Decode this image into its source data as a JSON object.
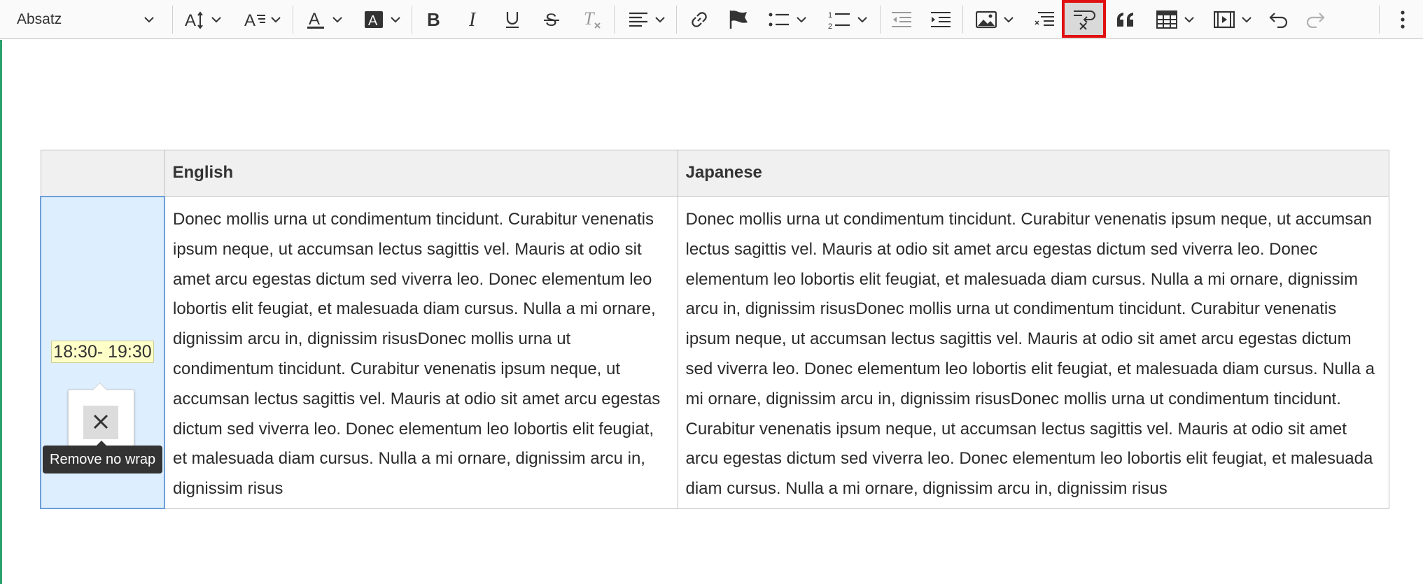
{
  "toolbar": {
    "heading": "Absatz",
    "buttons": [
      {
        "name": "font-size",
        "icon": "font-size-icon"
      },
      {
        "name": "font-family",
        "icon": "font-family-icon"
      },
      {
        "name": "font-color",
        "icon": "font-color-icon"
      },
      {
        "name": "background-color",
        "icon": "background-color-icon"
      },
      {
        "name": "bold",
        "icon": "bold-icon"
      },
      {
        "name": "italic",
        "icon": "italic-icon"
      },
      {
        "name": "underline",
        "icon": "underline-icon"
      },
      {
        "name": "strikethrough",
        "icon": "strikethrough-icon"
      },
      {
        "name": "remove-format",
        "icon": "remove-format-icon"
      },
      {
        "name": "alignment",
        "icon": "align-left-icon"
      },
      {
        "name": "link",
        "icon": "link-icon"
      },
      {
        "name": "bookmark",
        "icon": "flag-icon"
      },
      {
        "name": "bulleted-list",
        "icon": "bulleted-list-icon"
      },
      {
        "name": "numbered-list",
        "icon": "numbered-list-icon"
      },
      {
        "name": "outdent",
        "icon": "outdent-icon"
      },
      {
        "name": "indent",
        "icon": "indent-icon"
      },
      {
        "name": "insert-image",
        "icon": "image-icon"
      },
      {
        "name": "text-part-language",
        "icon": "text-language-icon"
      },
      {
        "name": "no-wrap",
        "icon": "no-wrap-icon",
        "active": true
      },
      {
        "name": "block-quote",
        "icon": "quote-icon"
      },
      {
        "name": "insert-table",
        "icon": "table-icon"
      },
      {
        "name": "media-embed",
        "icon": "media-icon"
      },
      {
        "name": "undo",
        "icon": "undo-icon"
      },
      {
        "name": "redo",
        "icon": "redo-icon"
      },
      {
        "name": "more",
        "icon": "more-vertical-icon"
      }
    ],
    "highlight_color": "#e01010"
  },
  "table": {
    "headers": [
      "",
      "English",
      "Japanese"
    ],
    "time": "18:30- 19:30",
    "english": "Donec mollis urna ut condimentum tincidunt. Curabitur venenatis ipsum neque, ut accumsan lectus sagittis vel. Mauris at odio sit amet arcu egestas dictum sed viverra leo. Donec elementum leo lobortis elit feugiat, et malesuada diam cursus. Nulla a mi ornare, dignissim arcu in, dignissim risusDonec mollis urna ut condimentum tincidunt. Curabitur venenatis ipsum neque, ut accumsan lectus sagittis vel. Mauris at odio sit amet arcu egestas dictum sed viverra leo. Donec elementum leo lobortis elit feugiat, et malesuada diam cursus. Nulla a mi ornare, dignissim arcu in, dignissim risus",
    "japanese": "Donec mollis urna ut condimentum tincidunt. Curabitur venenatis ipsum neque, ut accumsan lectus sagittis vel. Mauris at odio sit amet arcu egestas dictum sed viverra leo. Donec elementum leo lobortis elit feugiat, et malesuada diam cursus. Nulla a mi ornare, dignissim arcu in, dignissim risusDonec mollis urna ut condimentum tincidunt. Curabitur venenatis ipsum neque, ut accumsan lectus sagittis vel. Mauris at odio sit amet arcu egestas dictum sed viverra leo. Donec elementum leo lobortis elit feugiat, et malesuada diam cursus. Nulla a mi ornare, dignissim arcu in, dignissim risusDonec mollis urna ut condimentum tincidunt. Curabitur venenatis ipsum neque, ut accumsan lectus sagittis vel. Mauris at odio sit amet arcu egestas dictum sed viverra leo. Donec elementum leo lobortis elit feugiat, et malesuada diam cursus. Nulla a mi ornare, dignissim arcu in, dignissim risus"
  },
  "balloon": {
    "icon": "close-icon",
    "tooltip": "Remove no wrap"
  },
  "colors": {
    "selected_cell": "#ddeeff",
    "selected_border": "#6d9ed6",
    "highlighted_text": "#ffffc8",
    "editor_focus": "#2aa26d"
  }
}
